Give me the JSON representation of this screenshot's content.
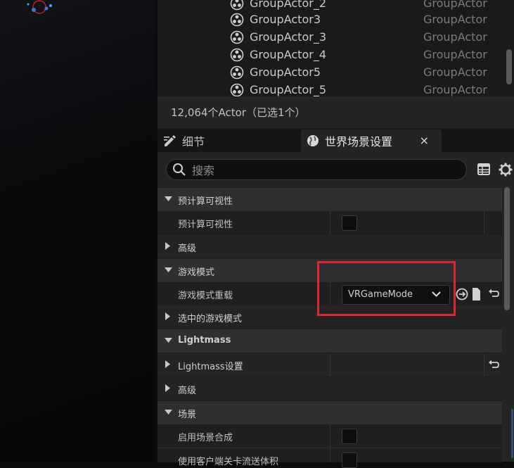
{
  "outliner": {
    "rows": [
      {
        "name": "GroupActor_2",
        "type": "GroupActor"
      },
      {
        "name": "GroupActor3",
        "type": "GroupActor"
      },
      {
        "name": "GroupActor_3",
        "type": "GroupActor"
      },
      {
        "name": "GroupActor_4",
        "type": "GroupActor"
      },
      {
        "name": "GroupActor5",
        "type": "GroupActor"
      },
      {
        "name": "GroupActor_5",
        "type": "GroupActor"
      }
    ],
    "footer": "12,064个Actor（已选1个）"
  },
  "tabs": {
    "details": "细节",
    "world_settings": "世界场景设置",
    "close": "×"
  },
  "search": {
    "placeholder": "搜索"
  },
  "sections": {
    "precomputed_visibility": "预计算可视性",
    "precomputed_visibility_prop": "预计算可视性",
    "advanced_1": "高级",
    "game_mode": "游戏模式",
    "game_mode_override": "游戏模式重载",
    "game_mode_value": "VRGameMode",
    "selected_game_mode": "选中的游戏模式",
    "lightmass": "Lightmass",
    "lightmass_settings": "Lightmass设置",
    "advanced_2": "高级",
    "scene": "场景",
    "enable_world_composition": "启用场景合成",
    "use_client_side_level_streaming": "使用客户端关卡流送体积"
  },
  "colors": {
    "highlight": "#e0272c",
    "panel_bg": "#242424",
    "category_bg": "#2f2f2f"
  }
}
